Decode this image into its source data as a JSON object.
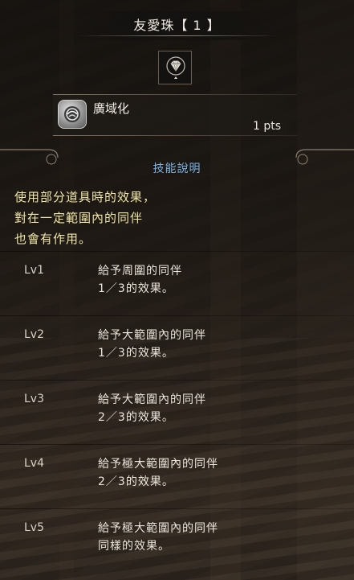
{
  "decoration": {
    "title": "友愛珠【 1 】",
    "slot_icon": "gem-icon"
  },
  "skill": {
    "icon": "emblem-icon",
    "name": "廣域化",
    "points": "1 pts"
  },
  "description": {
    "header": "技能說明",
    "lines": [
      "使用部分道具時的效果，",
      "對在一定範圍內的同伴",
      "也會有作用。"
    ]
  },
  "levels": [
    {
      "label": "Lv1",
      "line1": "給予周圍的同伴",
      "line2": "1／3的效果。"
    },
    {
      "label": "Lv2",
      "line1": "給予大範圍內的同伴",
      "line2": "1／3的效果。"
    },
    {
      "label": "Lv3",
      "line1": "給予大範圍內的同伴",
      "line2": "2／3的效果。"
    },
    {
      "label": "Lv4",
      "line1": "給予極大範圍內的同伴",
      "line2": "2／3的效果。"
    },
    {
      "label": "Lv5",
      "line1": "給予極大範圍內的同伴",
      "line2": "同樣的效果。"
    }
  ],
  "colors": {
    "header_blue": "#7fb5e6",
    "description_yellow": "#f0e6a6"
  }
}
